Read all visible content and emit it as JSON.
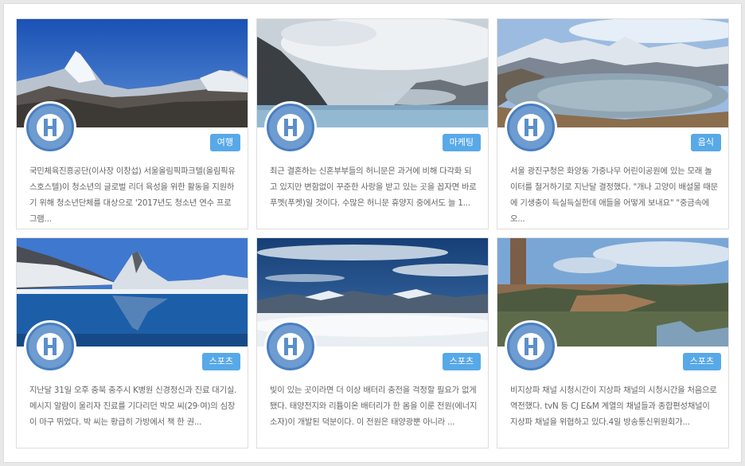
{
  "cards": [
    {
      "scene": "matterhorn",
      "tag": "여행",
      "excerpt": "국민체육진흥공단(이사장 이창섭) 서울올림픽파크텔(올림픽유스호스텔)이 청소년의 글로벌 리더 육성을 위한 활동을 지원하기 위해 청소년단체를 대상으로 '2017년도 청소년 연수 프로그램..."
    },
    {
      "scene": "misty-lake",
      "tag": "마케팅",
      "excerpt": "최근 결혼하는 신혼부부들의 허니문은 과거에 비해 다각화 되고 있지만 변함없이 꾸준한 사랑을 받고 있는 곳을 꼽자면 바로 푸껫(푸켓)일 것이다. 수많은 허니문 휴양지 중에서도 늘 1..."
    },
    {
      "scene": "alpine-lake",
      "tag": "음식",
      "excerpt": "서울 광진구청은 화양동 가중나무 어린이공원에 있는 모래 놀이터를 철거하기로 지난달 결정했다. \"개나 고양이 배설물 때문에 기생충이 득실득실한데 애들을 어떻게 보내요\" \"중금속에 오..."
    },
    {
      "scene": "matterhorn-lake",
      "tag": "스포츠",
      "excerpt": "지난달 31일 오후 충북 충주시 K병원 신경정신과 진료 대기실. 메시지 알람이 울리자 진료를 기다리던 박모 씨(29·여)의 심장이 마구 뛰었다. 박 씨는 황급히 가방에서 책 한 권..."
    },
    {
      "scene": "above-clouds",
      "tag": "스포츠",
      "excerpt": "빛이 있는 곳이라면 더 이상 배터리 충전을 걱정할 필요가 없게 됐다. 태양전지와 리튬이온 배터리가 한 몸을 이룬 전원(에너지 소자)이 개발된 덕분이다. 이 전원은 태양광뿐 아니라 ..."
    },
    {
      "scene": "old-town",
      "tag": "스포츠",
      "excerpt": "비지상파 채널 시청시간이 지상파 채널의 시청시간을 처음으로 역전했다. tvN 등 CJ E&M 계열의 채널들과 종합편성채널이 지상파 채널을 위협하고 있다.4일 방송통신위원회가..."
    }
  ]
}
